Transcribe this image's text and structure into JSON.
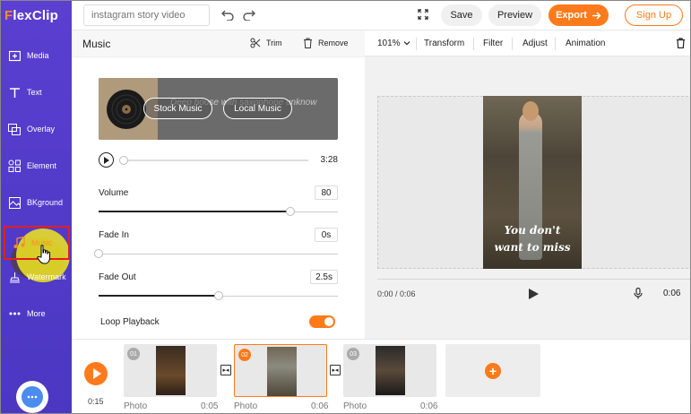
{
  "app": {
    "logo_letter": "F",
    "logo_rest": "lexClip"
  },
  "topbar": {
    "search_placeholder": "instagram story video",
    "save_label": "Save",
    "preview_label": "Preview",
    "export_label": "Export",
    "signup_label": "Sign Up"
  },
  "sidebar": {
    "items": [
      {
        "label": "Media",
        "icon": "media-icon"
      },
      {
        "label": "Text",
        "icon": "text-icon"
      },
      {
        "label": "Overlay",
        "icon": "overlay-icon"
      },
      {
        "label": "Element",
        "icon": "element-icon"
      },
      {
        "label": "BKground",
        "icon": "background-icon"
      },
      {
        "label": "Music",
        "icon": "music-icon",
        "active": true
      },
      {
        "label": "Watermark",
        "icon": "watermark-icon"
      },
      {
        "label": "More",
        "icon": "more-icon"
      }
    ]
  },
  "music_panel": {
    "title": "Music",
    "trim_label": "Trim",
    "remove_label": "Remove",
    "track_title": "Deep house with saxophone unknow",
    "stock_music_label": "Stock Music",
    "local_music_label": "Local Music",
    "duration": "3:28",
    "playback_position": 0,
    "volume": {
      "label": "Volume",
      "value": "80",
      "fraction": 0.8
    },
    "fade_in": {
      "label": "Fade In",
      "value": "0s",
      "fraction": 0
    },
    "fade_out": {
      "label": "Fade Out",
      "value": "2.5s",
      "fraction": 0.5
    },
    "loop_label": "Loop Playback",
    "loop_enabled": true
  },
  "editor": {
    "zoom": "101%",
    "tools": [
      "Transform",
      "Filter",
      "Adjust",
      "Animation"
    ],
    "caption_line1": "You don't",
    "caption_line2": "want to miss",
    "current_time": "0:00 / 0:06",
    "duration": "0:06"
  },
  "timeline": {
    "total_time": "0:15",
    "clips": [
      {
        "num": "01",
        "type": "Photo",
        "duration": "0:05",
        "selected": false
      },
      {
        "num": "02",
        "type": "Photo",
        "duration": "0:06",
        "selected": true
      },
      {
        "num": "03",
        "type": "Photo",
        "duration": "0:06",
        "selected": false
      }
    ]
  },
  "colors": {
    "accent": "#ff7a1a",
    "sidebar": "#5a3fd0",
    "active_outline": "#e02020"
  }
}
